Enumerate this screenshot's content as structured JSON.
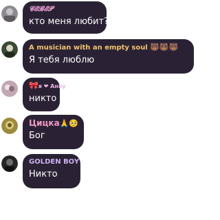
{
  "messages": [
    {
      "name": "𝓒𝓔𝓑𝓔𝓟",
      "name_color": "#e79ad0",
      "text": "кто меня любит?",
      "avatar_color": "#8d8b8f",
      "emojis": ""
    },
    {
      "name": "A musician with an empty soul",
      "name_color": "#f2c46c",
      "text": "Я тебя люблю",
      "avatar_color": "#3b4a35",
      "emojis": "🐻🐻🐻"
    },
    {
      "name": "я ❤ Анну",
      "name_color": "#e8b6e0",
      "text": "никто",
      "avatar_color": "#c3a7b2",
      "emojis": "🎀"
    },
    {
      "name": "Цицка",
      "name_color": "#f29ac6",
      "text": "Бог",
      "avatar_color": "#9c8a3e",
      "emojis": "🙏🥺"
    },
    {
      "name": "GOLDEN BOY",
      "name_color": "#cbb1f2",
      "text": "Никто",
      "avatar_color": "#262626",
      "emojis": ""
    }
  ]
}
